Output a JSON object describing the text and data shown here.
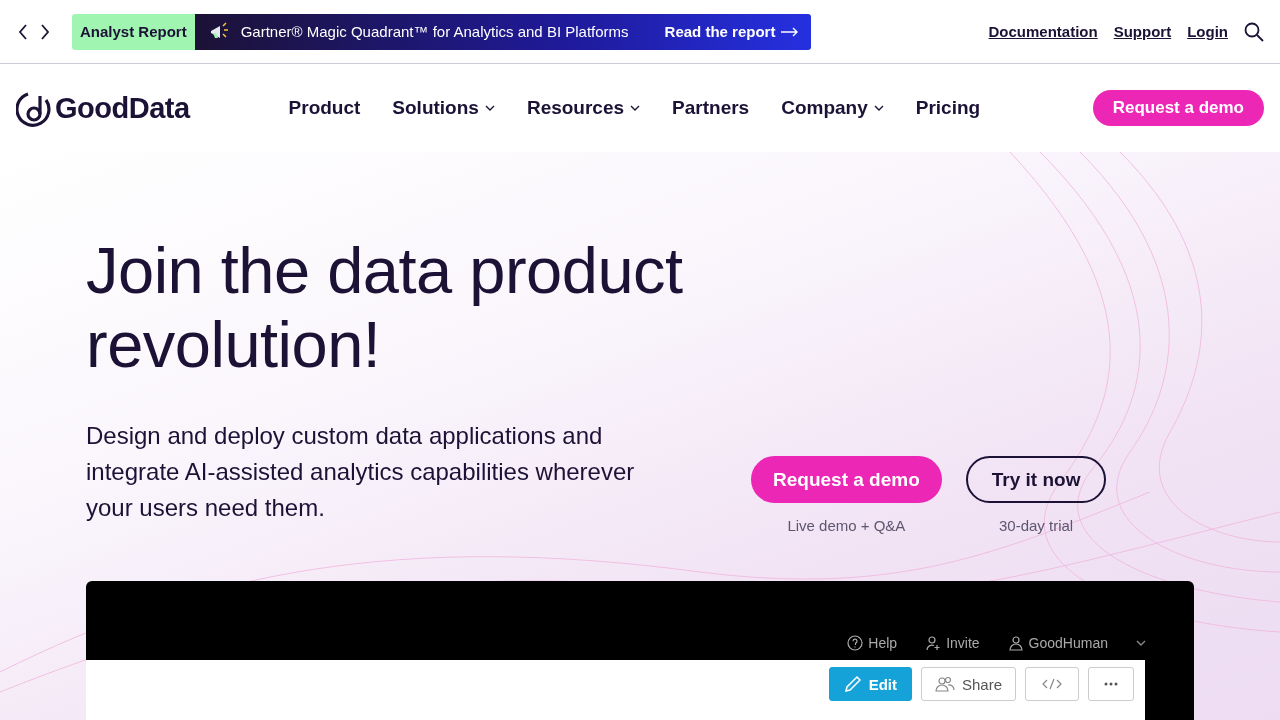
{
  "announcement": {
    "tag": "Analyst Report",
    "text": "Gartner® Magic Quadrant™ for Analytics and BI Platforms",
    "link": "Read the report"
  },
  "utility_links": [
    "Documentation",
    "Support",
    "Login"
  ],
  "brand": "GoodData",
  "nav": [
    {
      "label": "Product",
      "dropdown": false
    },
    {
      "label": "Solutions",
      "dropdown": true
    },
    {
      "label": "Resources",
      "dropdown": true
    },
    {
      "label": "Partners",
      "dropdown": false
    },
    {
      "label": "Company",
      "dropdown": true
    },
    {
      "label": "Pricing",
      "dropdown": false
    }
  ],
  "nav_cta": "Request a demo",
  "hero": {
    "title": "Join the data product revolution!",
    "subtitle": "Design and deploy custom data applications and integrate AI-assisted analytics capabilities wherever your users need them.",
    "actions": [
      {
        "label": "Request a demo",
        "note": "Live demo + Q&A",
        "kind": "primary"
      },
      {
        "label": "Try it now",
        "note": "30-day trial",
        "kind": "outline"
      }
    ]
  },
  "app_preview": {
    "header_links": [
      {
        "label": "Help",
        "kind": "help"
      },
      {
        "label": "Invite",
        "kind": "invite"
      },
      {
        "label": "GoodHuman",
        "kind": "user"
      }
    ],
    "toolbar": [
      {
        "label": "Edit",
        "kind": "edit"
      },
      {
        "label": "Share",
        "kind": "share"
      },
      {
        "kind": "embed"
      },
      {
        "kind": "more"
      }
    ]
  }
}
